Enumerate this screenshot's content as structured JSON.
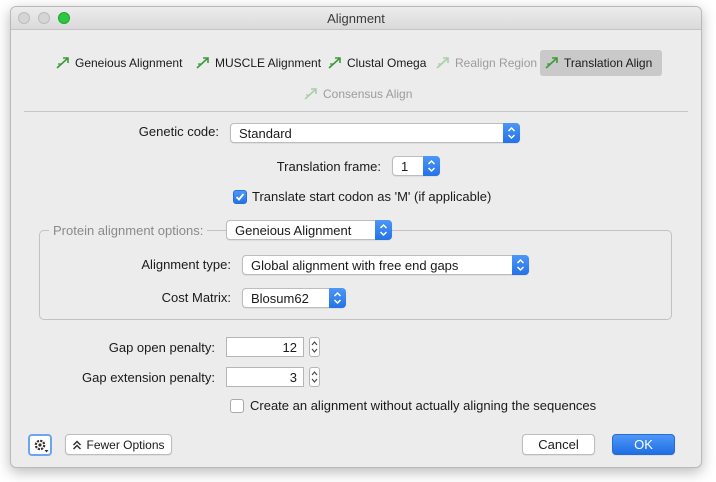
{
  "window": {
    "title": "Alignment"
  },
  "tabs": [
    {
      "label": "Geneious Alignment",
      "state": "enabled"
    },
    {
      "label": "MUSCLE Alignment",
      "state": "enabled"
    },
    {
      "label": "Clustal Omega",
      "state": "enabled"
    },
    {
      "label": "Realign Region",
      "state": "disabled"
    },
    {
      "label": "Translation Align",
      "state": "selected"
    },
    {
      "label": "Consensus Align",
      "state": "disabled"
    }
  ],
  "form": {
    "genetic_code_label": "Genetic code:",
    "genetic_code_value": "Standard",
    "translation_frame_label": "Translation frame:",
    "translation_frame_value": "1",
    "translate_start_label": "Translate start codon as 'M' (if applicable)",
    "translate_start_checked": true,
    "protein_group_label": "Protein alignment options:",
    "protein_method_value": "Geneious Alignment",
    "alignment_type_label": "Alignment type:",
    "alignment_type_value": "Global alignment with free end gaps",
    "cost_matrix_label": "Cost Matrix:",
    "cost_matrix_value": "Blosum62",
    "gap_open_label": "Gap open penalty:",
    "gap_open_value": "12",
    "gap_ext_label": "Gap extension penalty:",
    "gap_ext_value": "3",
    "no_align_label": "Create an alignment without actually aligning the sequences",
    "no_align_checked": false
  },
  "footer": {
    "fewer_options_label": "Fewer Options",
    "cancel_label": "Cancel",
    "ok_label": "OK"
  },
  "colors": {
    "accent": "#2f7df0",
    "tab_icon_green": "#3c9a3c",
    "tab_icon_disabled": "#a9cfa9",
    "window_bg": "#ececec"
  },
  "icons": {
    "tab_icon": "alignment-arrow-icon",
    "popup_arrow": "chevron-up-down-icon",
    "settings": "gear-icon",
    "fewer_options": "double-chevron-up-icon"
  }
}
